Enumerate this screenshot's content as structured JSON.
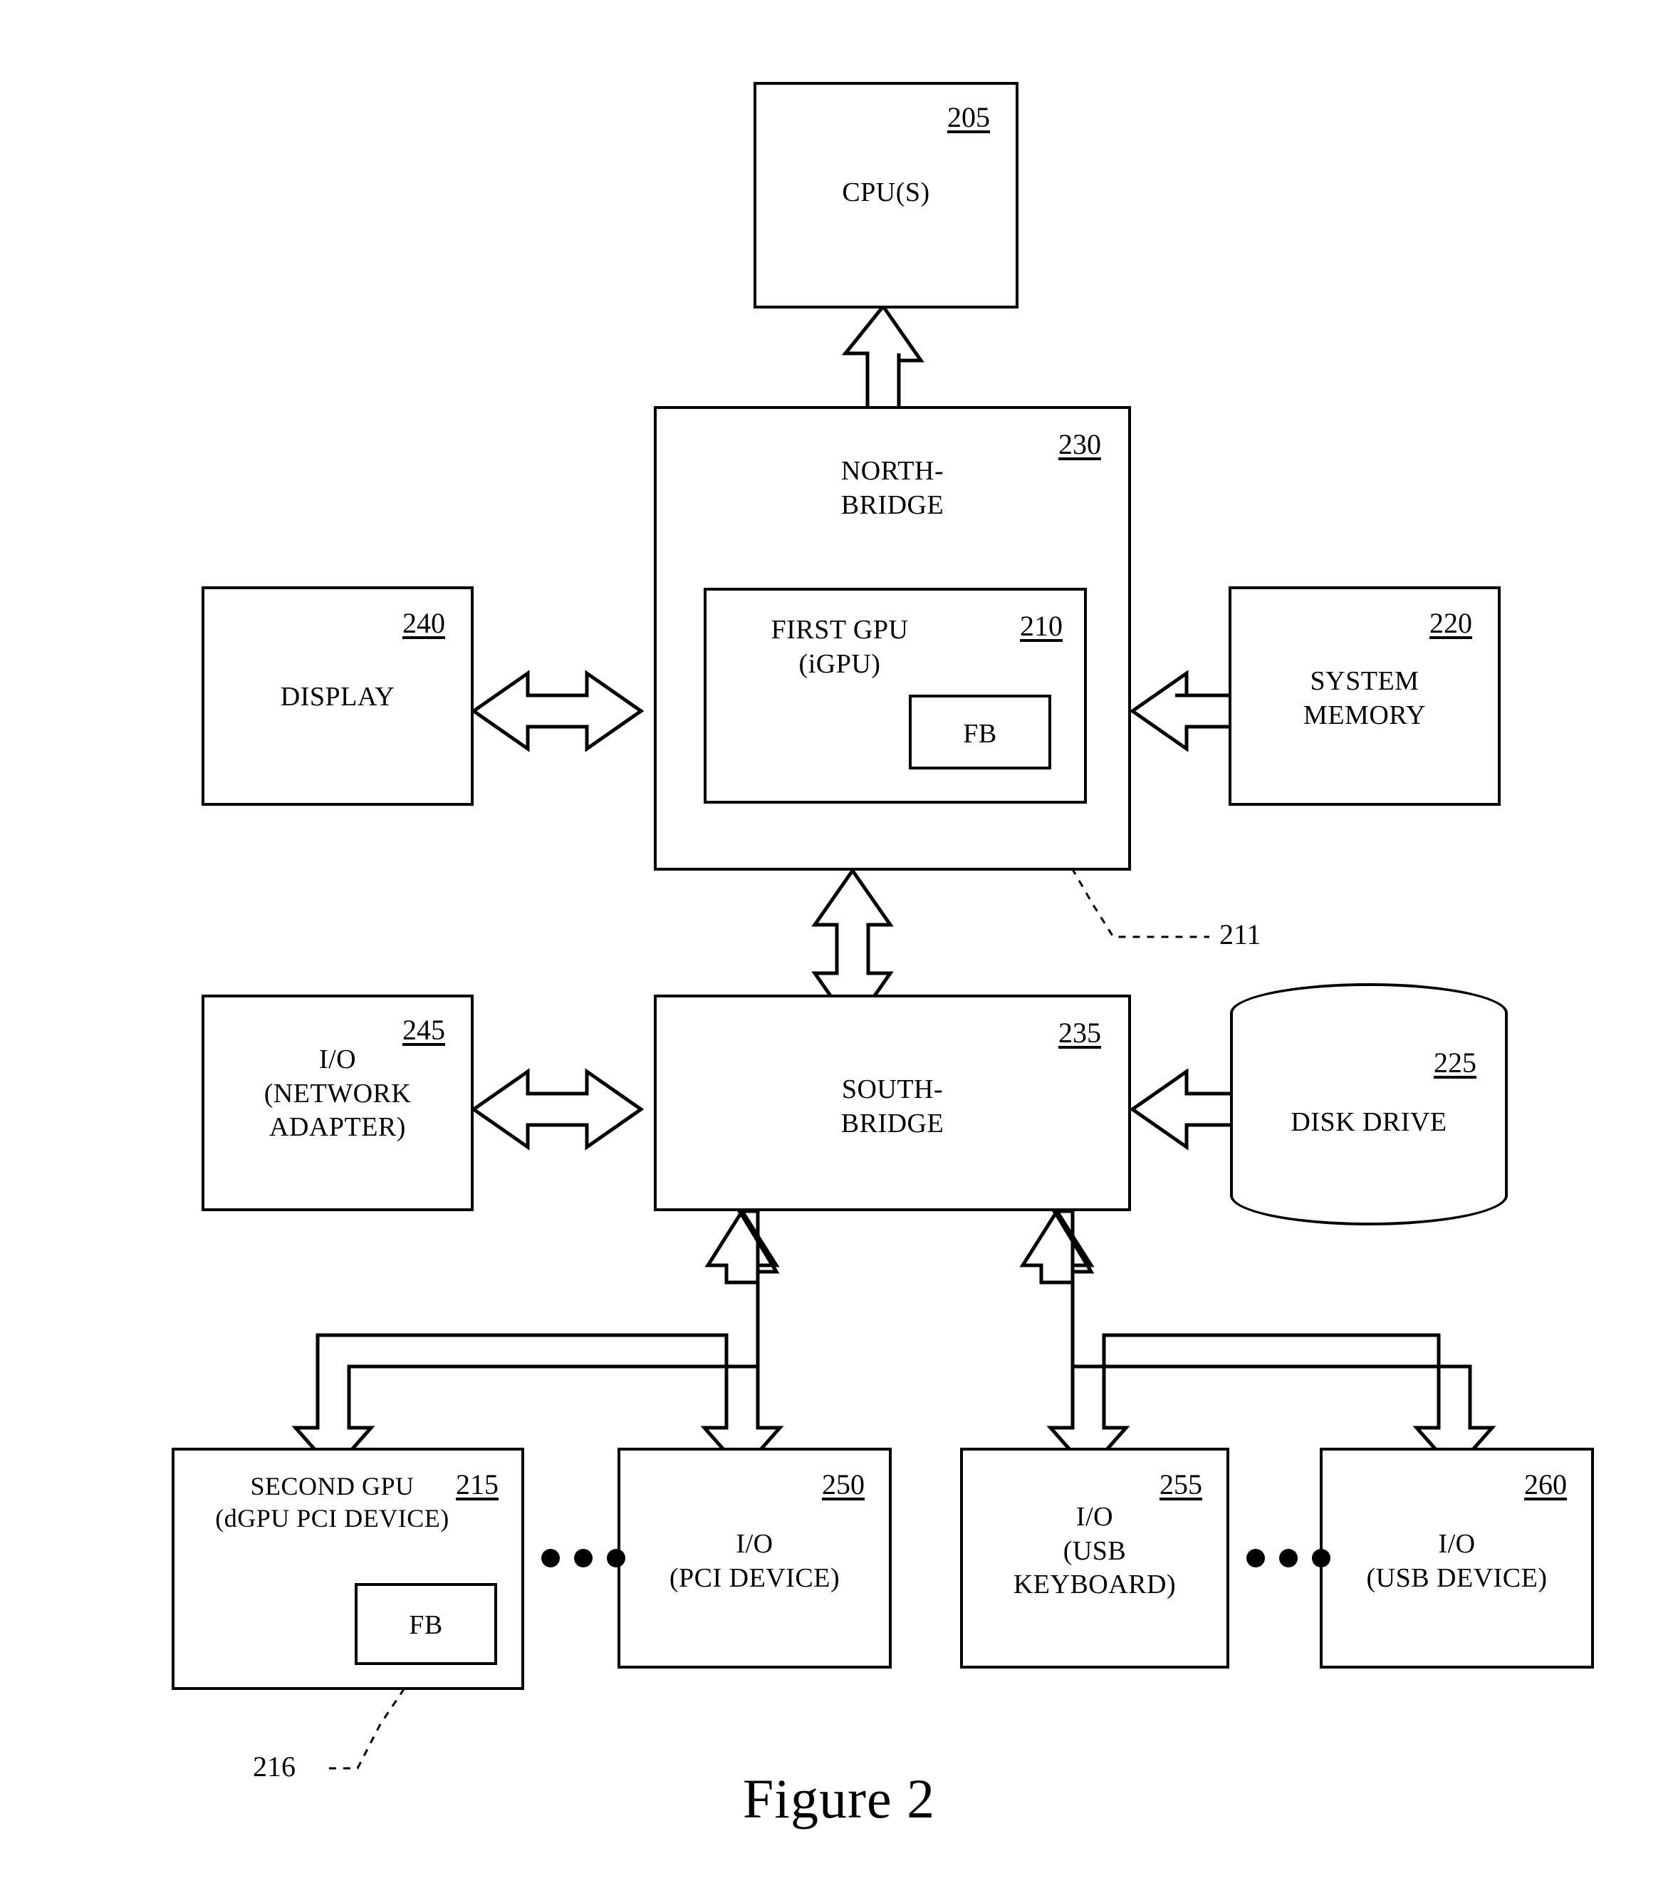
{
  "figure": {
    "caption": "Figure 2"
  },
  "nodes": {
    "cpu": {
      "label": "CPU(S)",
      "ref": "205"
    },
    "northbridge": {
      "label": "NORTH-\nBRIDGE",
      "ref": "230"
    },
    "igpu": {
      "label": "FIRST GPU\n(iGPU)",
      "ref": "210"
    },
    "igpu_fb": {
      "label": "FB",
      "ref": "211"
    },
    "display": {
      "label": "DISPLAY",
      "ref": "240"
    },
    "sysmem": {
      "label": "SYSTEM\nMEMORY",
      "ref": "220"
    },
    "southbridge": {
      "label": "SOUTH-\nBRIDGE",
      "ref": "235"
    },
    "netadapter": {
      "label": "I/O\n(NETWORK\nADAPTER)",
      "ref": "245"
    },
    "diskdrive": {
      "label": "DISK DRIVE",
      "ref": "225"
    },
    "dgpu": {
      "label": "SECOND GPU\n(dGPU PCI DEVICE)",
      "ref": "215"
    },
    "dgpu_fb": {
      "label": "FB",
      "ref": "216"
    },
    "pcidevice": {
      "label": "I/O\n(PCI DEVICE)",
      "ref": "250"
    },
    "usbkeyboard": {
      "label": "I/O\n(USB\nKEYBOARD)",
      "ref": "255"
    },
    "usbdevice": {
      "label": "I/O\n(USB DEVICE)",
      "ref": "260"
    }
  },
  "colors": {
    "stroke": "#000000",
    "fill": "#ffffff"
  }
}
